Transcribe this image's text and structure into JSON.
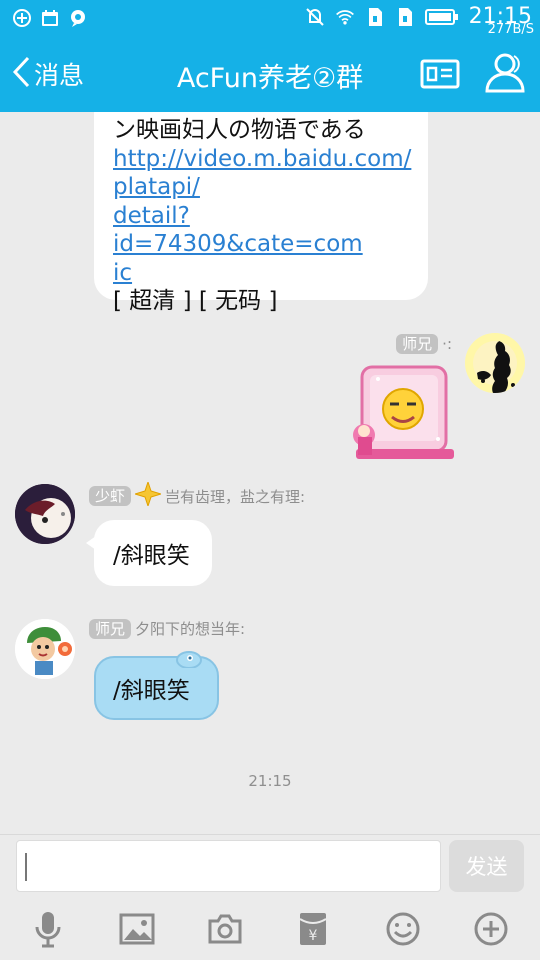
{
  "status_bar": {
    "time": "21:15",
    "net_speed": "277B/S",
    "icons": [
      "add-circle-icon",
      "calendar-icon",
      "chat-bubble-icon",
      "mute-icon",
      "wifi-icon",
      "sim1-icon",
      "sim2-icon",
      "battery-icon"
    ]
  },
  "header": {
    "back_label": "消息",
    "title": "AcFun养老②群",
    "icons": [
      "group-card-icon",
      "group-members-icon"
    ]
  },
  "chat": {
    "messages": [
      {
        "sender": "other",
        "lines": [
          "ン映画妇人の物语である"
        ],
        "link_lines": [
          "http://video.m.baidu.com/",
          "platapi/",
          "detail?id=74309&cate=com",
          "ic"
        ],
        "footer": "[ 超清 ] [ 无码 ]"
      },
      {
        "sender": "self",
        "name_tag": "师兄",
        "nickname": "·:",
        "content": "sticker"
      },
      {
        "sender": "other",
        "name_tag": "少虾",
        "badge_icon": "star-badge-icon",
        "nickname": "岂有齿理，盐之有理:",
        "text": "/斜眼笑"
      },
      {
        "sender": "other",
        "name_tag": "师兄",
        "nickname": "夕阳下的想当年:",
        "text": "/斜眼笑"
      }
    ],
    "timestamp": "21:15"
  },
  "input": {
    "value": "",
    "send_label": "发送"
  },
  "toolbar": {
    "icons": [
      "microphone-icon",
      "image-icon",
      "camera-icon",
      "red-packet-icon",
      "emoji-icon",
      "plus-icon"
    ]
  },
  "colors": {
    "header": "#15b1e7",
    "link": "#2a80d2",
    "background": "#ebebeb",
    "blue_bubble": "#a9dcf4"
  }
}
